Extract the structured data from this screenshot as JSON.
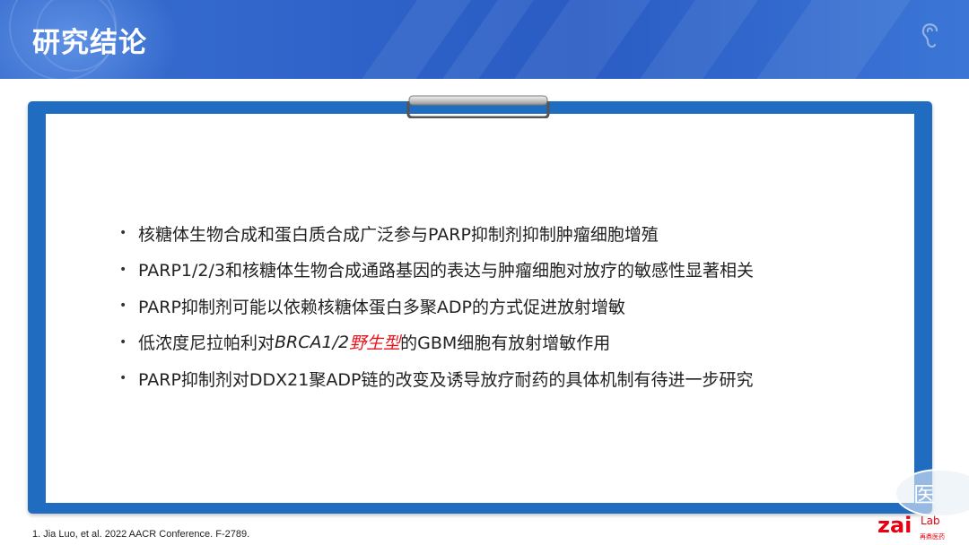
{
  "header": {
    "title": "研究结论"
  },
  "bullets": [
    {
      "parts": [
        {
          "text": "核糖体生物合成和蛋白质合成广泛参与PARP抑制剂抑制肿瘤细胞增殖",
          "style": "normal"
        }
      ]
    },
    {
      "parts": [
        {
          "text": "PARP1/2/3和核糖体生物合成通路基因的表达与肿瘤细胞对放疗的敏感性显著相关",
          "style": "normal"
        }
      ]
    },
    {
      "parts": [
        {
          "text": "PARP抑制剂可能以依赖核糖体蛋白多聚ADP的方式促进放射增敏",
          "style": "normal"
        }
      ]
    },
    {
      "parts": [
        {
          "text": "低浓度尼拉帕利对",
          "style": "normal"
        },
        {
          "text": "BRCA1/2",
          "style": "italic"
        },
        {
          "text": "野生型",
          "style": "red"
        },
        {
          "text": "的GBM细胞有放射增敏作用",
          "style": "normal"
        }
      ]
    },
    {
      "parts": [
        {
          "text": "PARP抑制剂对DDX21聚ADP链的改变及诱导放疗耐药的具体机制有待进一步研究",
          "style": "normal"
        }
      ]
    }
  ],
  "bullet_symbol": "•",
  "reference": "1.   Jia Luo, et al. 2022 AACR Conference. F-2789.",
  "watermark": {
    "text": "医"
  },
  "logo": {
    "text_zai": "zai",
    "text_lab": "Lab",
    "subtitle": "再鼎医药"
  },
  "colors": {
    "banner": "#2f63c9",
    "board_frame": "#1f6cc0",
    "highlight_red": "#e8141c",
    "logo_red": "#e60012"
  }
}
